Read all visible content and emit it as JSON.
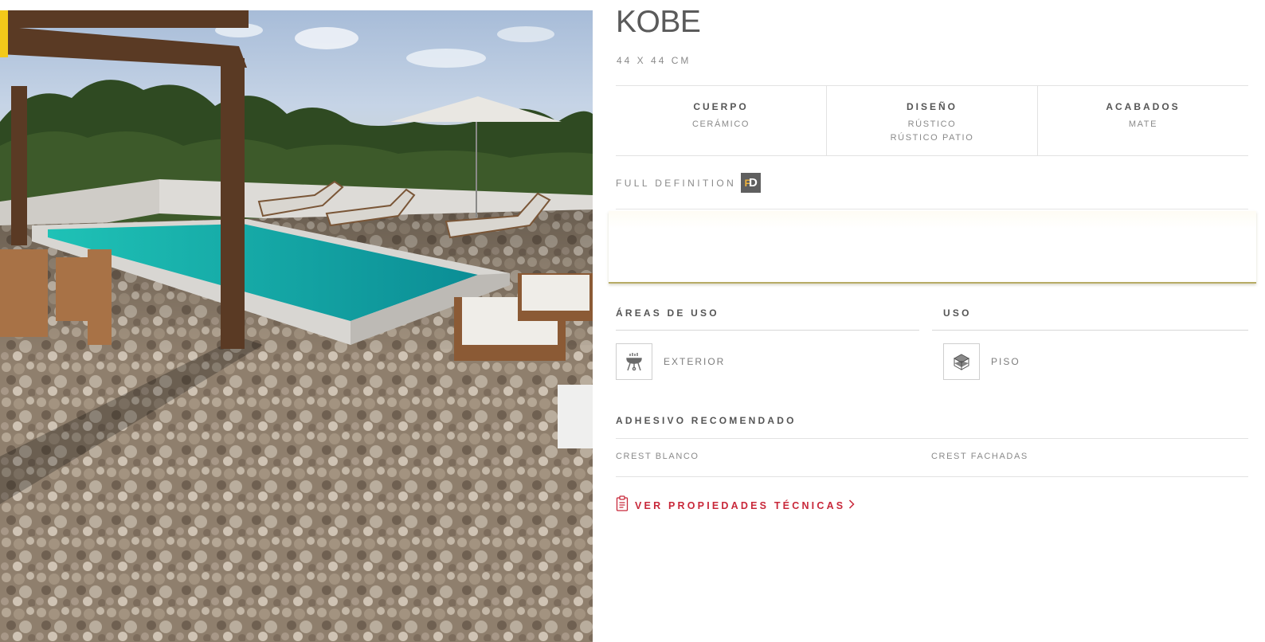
{
  "product": {
    "name": "KOBE",
    "dimensions": "44 X 44 CM"
  },
  "specs": [
    {
      "label": "CUERPO",
      "values": [
        "CERÁMICO"
      ]
    },
    {
      "label": "DISEÑO",
      "values": [
        "RÚSTICO",
        "RÚSTICO PATIO"
      ]
    },
    {
      "label": "ACABADOS",
      "values": [
        "MATE"
      ]
    }
  ],
  "full_definition": {
    "label": "FULL DEFINITION",
    "badge_text": "D",
    "badge_mark": "F"
  },
  "areas_de_uso": {
    "label": "ÁREAS DE USO",
    "items": [
      {
        "label": "EXTERIOR",
        "icon": "grill-icon"
      }
    ]
  },
  "uso": {
    "label": "USO",
    "items": [
      {
        "label": "PISO",
        "icon": "floor-cube-icon"
      }
    ]
  },
  "adhesivo": {
    "label": "ADHESIVO RECOMENDADO",
    "items": [
      "CREST BLANCO",
      "CREST FACHADAS"
    ]
  },
  "tech_link": {
    "label": "VER PROPIEDADES TÉCNICAS",
    "icon": "clipboard-icon",
    "color": "#c8283a"
  },
  "colors": {
    "accent_tab": "#f2c91a",
    "link": "#c8283a",
    "text_dark": "#555555",
    "text_muted": "#8a8a8a"
  }
}
